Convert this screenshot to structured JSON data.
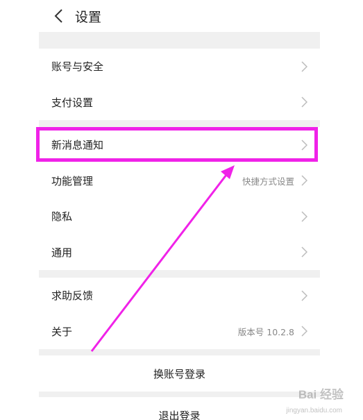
{
  "header": {
    "title": "设置",
    "back_icon": "chevron-left-icon"
  },
  "groups": [
    {
      "items": [
        {
          "label": "账号与安全"
        },
        {
          "label": "支付设置"
        }
      ]
    },
    {
      "items": [
        {
          "label": "新消息通知"
        },
        {
          "label": "功能管理",
          "value": "快捷方式设置"
        },
        {
          "label": "隐私"
        },
        {
          "label": "通用"
        }
      ]
    },
    {
      "items": [
        {
          "label": "求助反馈"
        },
        {
          "label": "关于",
          "value": "版本号 10.2.8"
        }
      ]
    }
  ],
  "actions": {
    "switch_account": "换账号登录",
    "logout": "退出登录"
  },
  "annotation": {
    "color": "#f022e8"
  },
  "watermark": {
    "brand": "Bai 经验",
    "sub": "jingyan.baidu.com"
  }
}
